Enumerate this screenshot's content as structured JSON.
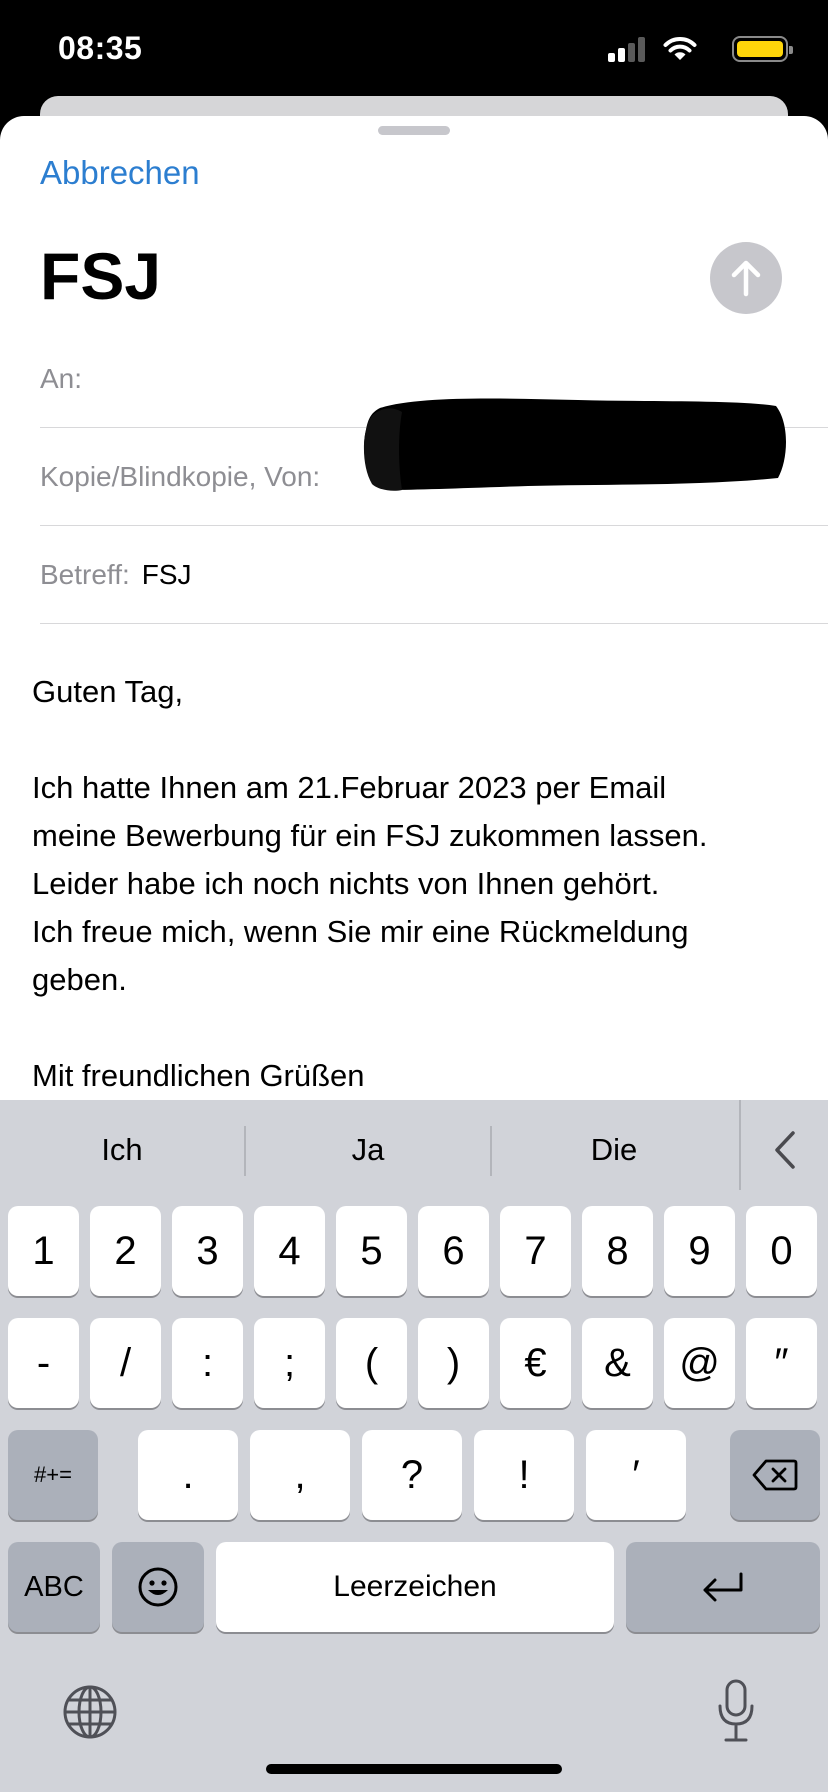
{
  "status_bar": {
    "time": "08:35",
    "signal_icon": "cellular-signal-icon",
    "wifi_icon": "wifi-icon",
    "battery_icon": "battery-icon",
    "battery_color": "#ffd60a"
  },
  "compose": {
    "cancel_label": "Abbrechen",
    "title": "FSJ",
    "send_icon": "arrow-up-icon",
    "accent_color": "#2c7ed0",
    "fields": {
      "to_label": "An:",
      "cc_label": "Kopie/Blindkopie, Von:",
      "subject_label": "Betreff:",
      "subject_value": "FSJ"
    },
    "body": {
      "greeting": "Guten Tag,",
      "paragraph_lines": [
        "Ich hatte Ihnen am 21.Februar 2023 per Email",
        "meine Bewerbung für ein FSJ zukommen lassen.",
        "Leider habe ich noch nichts von Ihnen gehört.",
        "Ich freue mich, wenn Sie mir eine Rückmeldung",
        "geben."
      ],
      "closing": "Mit freundlichen Grüßen"
    }
  },
  "keyboard": {
    "suggestions": [
      "Ich",
      "Ja",
      "Die"
    ],
    "row1": [
      "1",
      "2",
      "3",
      "4",
      "5",
      "6",
      "7",
      "8",
      "9",
      "0"
    ],
    "row2": [
      "-",
      "/",
      ":",
      ";",
      "(",
      ")",
      "€",
      "&",
      "@",
      "″"
    ],
    "row3_mode": "#+=",
    "row3": [
      ".",
      ",",
      "?",
      "!",
      "′"
    ],
    "abc_label": "ABC",
    "space_label": "Leerzeichen",
    "icons": {
      "collapse": "chevron-left-icon",
      "delete": "delete-backward-icon",
      "emoji": "emoji-icon",
      "return": "return-icon",
      "globe": "globe-icon",
      "mic": "microphone-icon"
    }
  }
}
